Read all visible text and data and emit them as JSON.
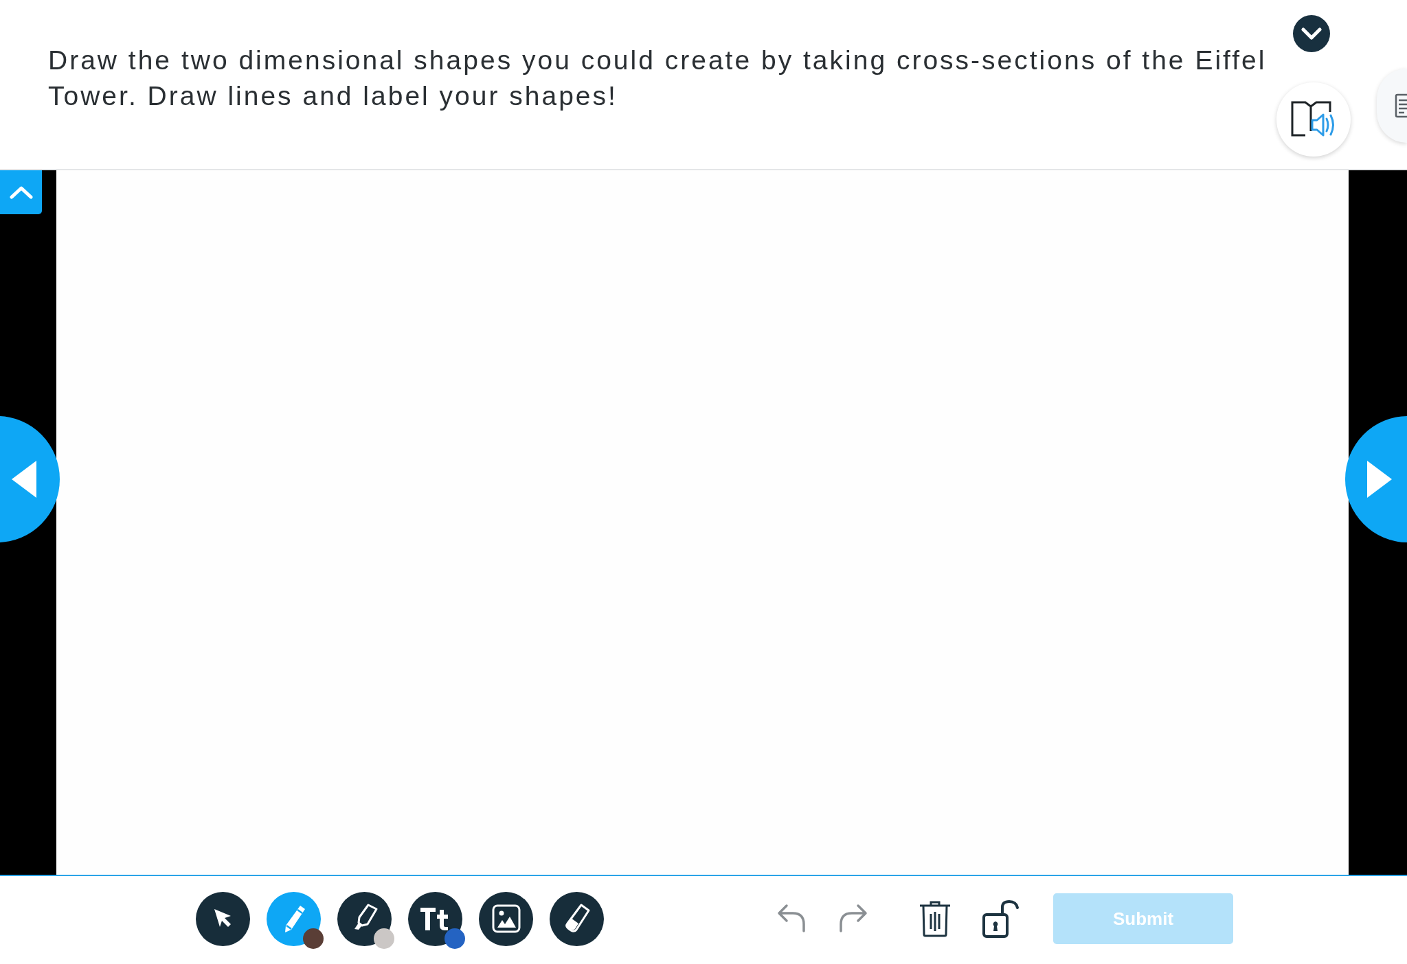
{
  "prompt": {
    "text": "Draw the two dimensional shapes you could create by taking cross-sections of the Eiffel Tower. Draw lines and label your shapes!"
  },
  "tools": [
    {
      "kind": "pointer",
      "selected": false
    },
    {
      "kind": "pen",
      "selected": true,
      "color": "#5a3e36"
    },
    {
      "kind": "highlighter",
      "selected": false,
      "color": "#cbc7c5"
    },
    {
      "kind": "text",
      "selected": false,
      "color": "#2463c2"
    },
    {
      "kind": "image",
      "selected": false
    },
    {
      "kind": "eraser",
      "selected": false
    }
  ],
  "submit": {
    "label": "Submit",
    "disabled": true
  }
}
